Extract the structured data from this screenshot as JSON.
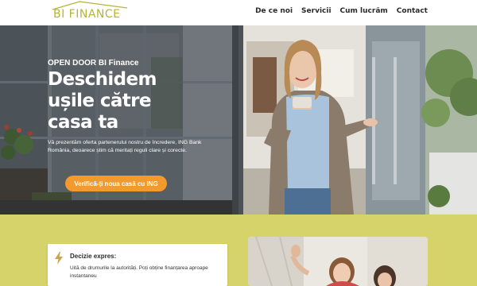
{
  "header": {
    "logo_text": "BI  FINANCE",
    "nav": [
      "De ce noi",
      "Servicii",
      "Cum lucrăm",
      "Contact"
    ]
  },
  "hero": {
    "eyebrow": "OPEN DOOR BI Finance",
    "title": "Deschidem ușile către casa ta",
    "description": "Vă prezentăm oferta partenerului nostru de încredere, ING Bank România, deoarece știm că meritați reguli clare și corecte.",
    "cta_label": "Verifică-ți noua casă cu ING"
  },
  "feature_card": {
    "icon": "lightning-bolt-icon",
    "title": "Decizie expres:",
    "description": "Uită de drumurile la autorități. Poți obține finanțarea aproape instantaneu"
  },
  "colors": {
    "accent": "#f39a2e",
    "section_bg": "#d6d36a",
    "logo": "#b7b23a"
  }
}
